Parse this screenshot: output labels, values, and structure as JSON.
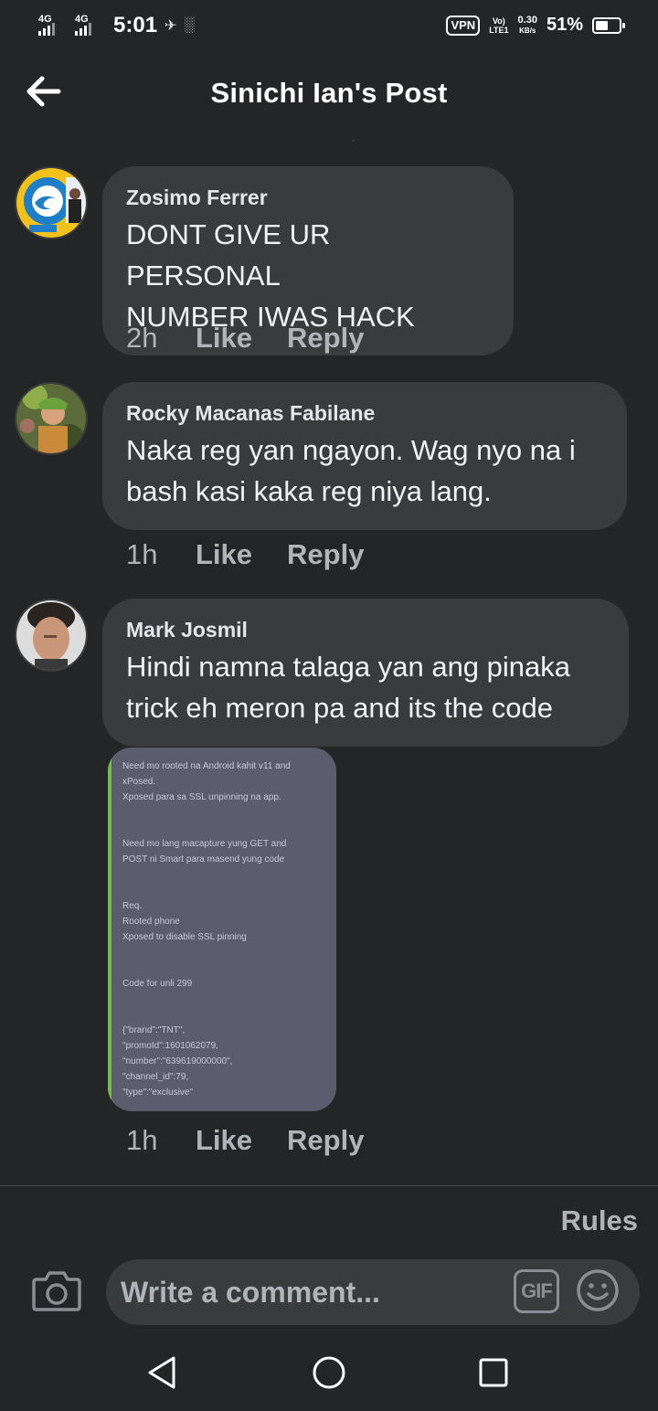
{
  "status_bar": {
    "network1": "4G",
    "network2": "4G",
    "time": "5:01",
    "vpn": "VPN",
    "volte_top": "Vo)",
    "volte_bottom": "LTE1",
    "speed_value": "0.30",
    "speed_unit": "KB/s",
    "battery": "51%",
    "battery_level": 0.51
  },
  "header": {
    "title": "Sinichi Ian's Post",
    "back_icon": "arrow-left-icon"
  },
  "comments": [
    {
      "author": "Zosimo Ferrer",
      "line1": "DONT GIVE UR PERSONAL",
      "line2": "NUMBER IWAS HACK",
      "time": "2h",
      "like": "Like",
      "reply": "Reply"
    },
    {
      "author": "Rocky Macanas Fabilane",
      "line1": "Naka reg yan ngayon. Wag nyo na i",
      "line2": "bash kasi kaka reg niya lang.",
      "time": "1h",
      "like": "Like",
      "reply": "Reply"
    },
    {
      "author": "Mark Josmil",
      "line1": "Hindi namna talaga yan ang pinaka",
      "line2": "trick eh meron pa and its the code",
      "time": "1h",
      "like": "Like",
      "reply": "Reply",
      "attachment_text": "Need mo rooted na Android kahit v11 and\nxPosed.\nXposed para sa SSL unpinning na app.\n\n\nNeed mo lang macapture yung GET and\nPOST ni Smart para masend yung code\n\n\nReq.\nRooted phone\nXposed to disable SSL pinning\n\n\nCode for unli 299\n\n\n{\"brand\":\"TNT\",\n\"promoId\":1601062079,\n\"number\":\"639619000000\",\n\"channel_id\":79,\n\"type\":\"exclusive\""
    }
  ],
  "rules_label": "Rules",
  "compose": {
    "placeholder": "Write a comment...",
    "gif_label": "GIF",
    "camera_icon": "camera-icon",
    "emoji_icon": "smiley-icon"
  },
  "navbar": {
    "back": "back-triangle-icon",
    "home": "home-circle-icon",
    "recents": "recents-square-icon"
  }
}
